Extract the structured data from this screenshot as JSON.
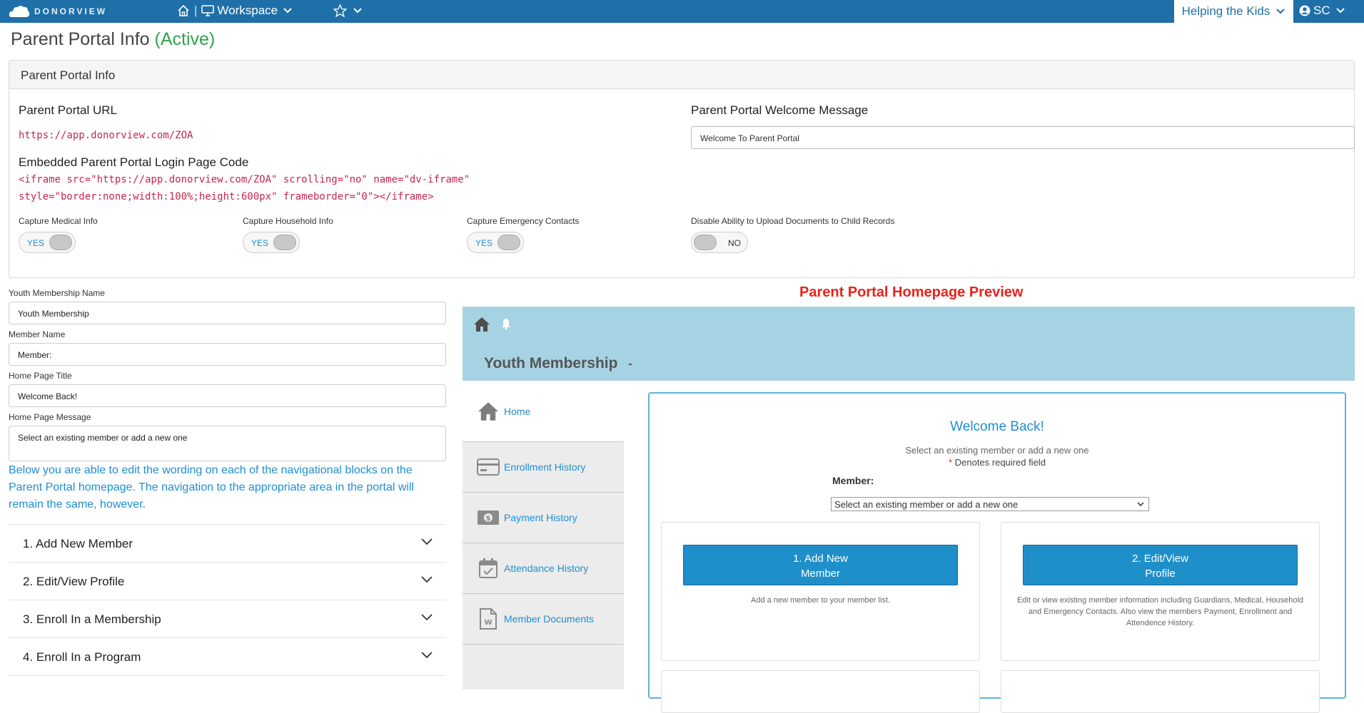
{
  "topbar": {
    "logo_text": "DONORVIEW",
    "workspace_label": "Workspace",
    "org_label": "Helping the Kids",
    "user_label": "SC"
  },
  "page": {
    "title": "Parent Portal Info",
    "status": "(Active)",
    "status_color": "#2ea34f"
  },
  "info_panel": {
    "header": "Parent Portal Info",
    "url_label": "Parent Portal URL",
    "url_value": "https://app.donorview.com/ZOA",
    "embed_label": "Embedded Parent Portal Login Page Code",
    "embed_line1": "<iframe src=\"https://app.donorview.com/ZOA\" scrolling=\"no\" name=\"dv-iframe\"",
    "embed_line2": "style=\"border:none;width:100%;height:600px\" frameborder=\"0\"></iframe>",
    "welcome_label": "Parent Portal Welcome Message",
    "welcome_value": "Welcome To Parent Portal",
    "toggles": [
      {
        "label": "Capture Medical Info",
        "state": "YES"
      },
      {
        "label": "Capture Household Info",
        "state": "YES"
      },
      {
        "label": "Capture Emergency Contacts",
        "state": "YES"
      },
      {
        "label": "Disable Ability to Upload Documents to Child Records",
        "state": "NO"
      }
    ]
  },
  "form": {
    "youth_label": "Youth Membership Name",
    "youth_value": "Youth Membership",
    "member_label": "Member Name",
    "member_value": "Member:",
    "home_title_label": "Home Page Title",
    "home_title_value": "Welcome Back!",
    "home_msg_label": "Home Page Message",
    "home_msg_value": "Select an existing member or add a new one",
    "note": "Below you are able to edit the wording on each of the navigational blocks on the Parent Portal homepage. The navigation to the appropriate area in the portal will remain the same, however."
  },
  "accordion": [
    "1. Add New Member",
    "2. Edit/View Profile",
    "3. Enroll In a Membership",
    "4. Enroll In a Program"
  ],
  "preview": {
    "title": "Parent Portal Homepage Preview",
    "title_color": "#e8231c",
    "header_title": "Youth Membership",
    "nav": [
      "Home",
      "Enrollment History",
      "Payment History",
      "Attendance History",
      "Member Documents"
    ],
    "welcome_title": "Welcome Back!",
    "welcome_msg": "Select an existing member or add a new one",
    "required_mark": "*",
    "required_text": "Denotes required field",
    "member_label": "Member:",
    "member_select": "Select an existing member or add a new one",
    "cards": [
      {
        "btn_line1": "1. Add New",
        "btn_line2": "Member",
        "desc": "Add a new member to your member list."
      },
      {
        "btn_line1": "2. Edit/View",
        "btn_line2": "Profile",
        "desc": "Edit or view existing member information including Guardians, Medical, Household and Emergency Contacts. Also view the members Payment, Enrollment and Attendence History."
      }
    ]
  }
}
